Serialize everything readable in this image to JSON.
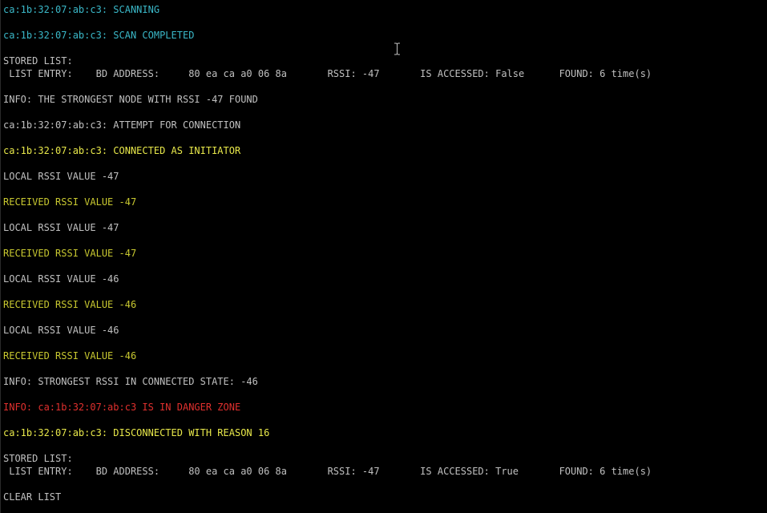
{
  "terminal": {
    "lines": [
      {
        "text": "ca:1b:32:07:ab:c3: SCANNING",
        "color": "#3ab8c8"
      },
      {
        "text": "",
        "color": "#c0c0c0"
      },
      {
        "text": "ca:1b:32:07:ab:c3: SCAN COMPLETED",
        "color": "#3ab8c8"
      },
      {
        "text": "",
        "color": "#c0c0c0"
      },
      {
        "text": "STORED LIST:",
        "color": "#c0c0c0"
      },
      {
        "text": " LIST ENTRY:    BD ADDRESS:     80 ea ca a0 06 8a       RSSI: -47       IS ACCESSED: False      FOUND: 6 time(s)",
        "color": "#c0c0c0"
      },
      {
        "text": "",
        "color": "#c0c0c0"
      },
      {
        "text": "INFO: THE STRONGEST NODE WITH RSSI -47 FOUND",
        "color": "#c0c0c0"
      },
      {
        "text": "",
        "color": "#c0c0c0"
      },
      {
        "text": "ca:1b:32:07:ab:c3: ATTEMPT FOR CONNECTION",
        "color": "#c0c0c0"
      },
      {
        "text": "",
        "color": "#c0c0c0"
      },
      {
        "text": "ca:1b:32:07:ab:c3: CONNECTED AS INITIATOR",
        "color": "#e8e84a"
      },
      {
        "text": "",
        "color": "#c0c0c0"
      },
      {
        "text": "LOCAL RSSI VALUE -47",
        "color": "#c0c0c0"
      },
      {
        "text": "",
        "color": "#c0c0c0"
      },
      {
        "text": "RECEIVED RSSI VALUE -47",
        "color": "#c8c830"
      },
      {
        "text": "",
        "color": "#c0c0c0"
      },
      {
        "text": "LOCAL RSSI VALUE -47",
        "color": "#c0c0c0"
      },
      {
        "text": "",
        "color": "#c0c0c0"
      },
      {
        "text": "RECEIVED RSSI VALUE -47",
        "color": "#c8c830"
      },
      {
        "text": "",
        "color": "#c0c0c0"
      },
      {
        "text": "LOCAL RSSI VALUE -46",
        "color": "#c0c0c0"
      },
      {
        "text": "",
        "color": "#c0c0c0"
      },
      {
        "text": "RECEIVED RSSI VALUE -46",
        "color": "#c8c830"
      },
      {
        "text": "",
        "color": "#c0c0c0"
      },
      {
        "text": "LOCAL RSSI VALUE -46",
        "color": "#c0c0c0"
      },
      {
        "text": "",
        "color": "#c0c0c0"
      },
      {
        "text": "RECEIVED RSSI VALUE -46",
        "color": "#c8c830"
      },
      {
        "text": "",
        "color": "#c0c0c0"
      },
      {
        "text": "INFO: STRONGEST RSSI IN CONNECTED STATE: -46",
        "color": "#c0c0c0"
      },
      {
        "text": "",
        "color": "#c0c0c0"
      },
      {
        "text": "INFO: ca:1b:32:07:ab:c3 IS IN DANGER ZONE",
        "color": "#e0302e"
      },
      {
        "text": "",
        "color": "#c0c0c0"
      },
      {
        "text": "ca:1b:32:07:ab:c3: DISCONNECTED WITH REASON 16",
        "color": "#e8e84a"
      },
      {
        "text": "",
        "color": "#c0c0c0"
      },
      {
        "text": "STORED LIST:",
        "color": "#c0c0c0"
      },
      {
        "text": " LIST ENTRY:    BD ADDRESS:     80 ea ca a0 06 8a       RSSI: -47       IS ACCESSED: True       FOUND: 6 time(s)",
        "color": "#c0c0c0"
      },
      {
        "text": "",
        "color": "#c0c0c0"
      },
      {
        "text": "CLEAR LIST",
        "color": "#c0c0c0"
      }
    ]
  },
  "cursor": {
    "icon": "i-beam-text-cursor"
  }
}
